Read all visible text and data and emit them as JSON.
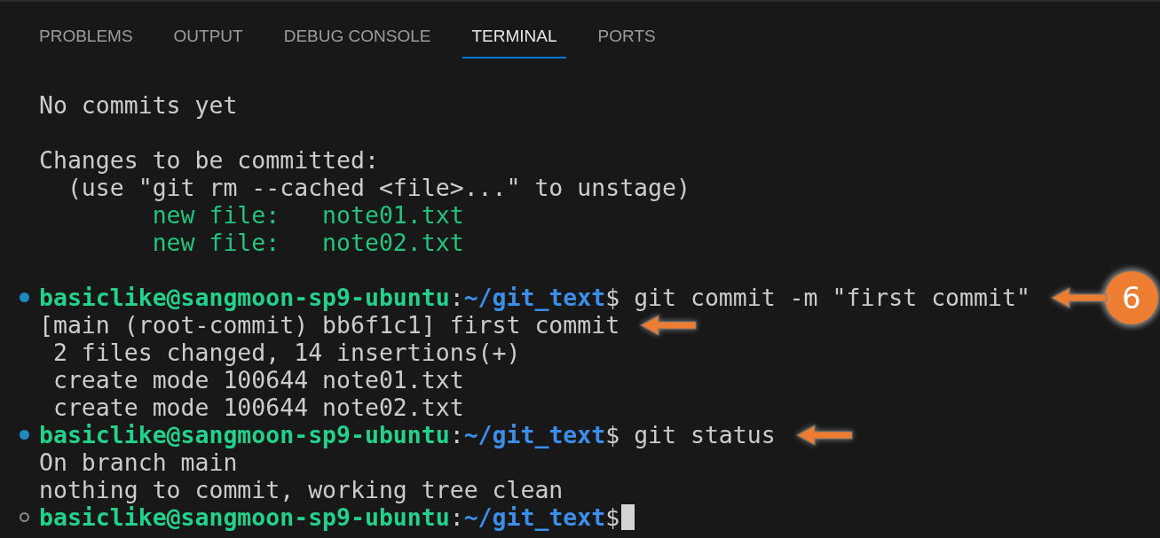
{
  "tabs": [
    {
      "label": "PROBLEMS",
      "selected": false
    },
    {
      "label": "OUTPUT",
      "selected": false
    },
    {
      "label": "DEBUG CONSOLE",
      "selected": false
    },
    {
      "label": "TERMINAL",
      "selected": true
    },
    {
      "label": "PORTS",
      "selected": false
    }
  ],
  "terminal": {
    "lines": [
      {
        "kind": "blank"
      },
      {
        "kind": "text",
        "text": "No commits yet"
      },
      {
        "kind": "blank"
      },
      {
        "kind": "text",
        "text": "Changes to be committed:"
      },
      {
        "kind": "text",
        "text": "  (use \"git rm --cached <file>...\" to unstage)"
      },
      {
        "kind": "staged",
        "text": "        new file:   note01.txt"
      },
      {
        "kind": "staged",
        "text": "        new file:   note02.txt"
      },
      {
        "kind": "blank"
      },
      {
        "kind": "prompt",
        "done": true,
        "user": "basiclike@sangmoon-sp9-ubuntu",
        "colon": ":",
        "path": "~/git_text",
        "dollar": "$",
        "command": " git commit -m \"first commit\"",
        "arrow": true,
        "badge": "6"
      },
      {
        "kind": "text",
        "text": "[main (root-commit) bb6f1c1] first commit",
        "arrow": true
      },
      {
        "kind": "text",
        "text": " 2 files changed, 14 insertions(+)"
      },
      {
        "kind": "text",
        "text": " create mode 100644 note01.txt"
      },
      {
        "kind": "text",
        "text": " create mode 100644 note02.txt"
      },
      {
        "kind": "prompt",
        "done": true,
        "user": "basiclike@sangmoon-sp9-ubuntu",
        "colon": ":",
        "path": "~/git_text",
        "dollar": "$",
        "command": " git status",
        "arrow": true
      },
      {
        "kind": "text",
        "text": "On branch main"
      },
      {
        "kind": "text",
        "text": "nothing to commit, working tree clean"
      },
      {
        "kind": "prompt",
        "done": false,
        "user": "basiclike@sangmoon-sp9-ubuntu",
        "colon": ":",
        "path": "~/git_text",
        "dollar": "$",
        "cursor": true
      }
    ]
  }
}
